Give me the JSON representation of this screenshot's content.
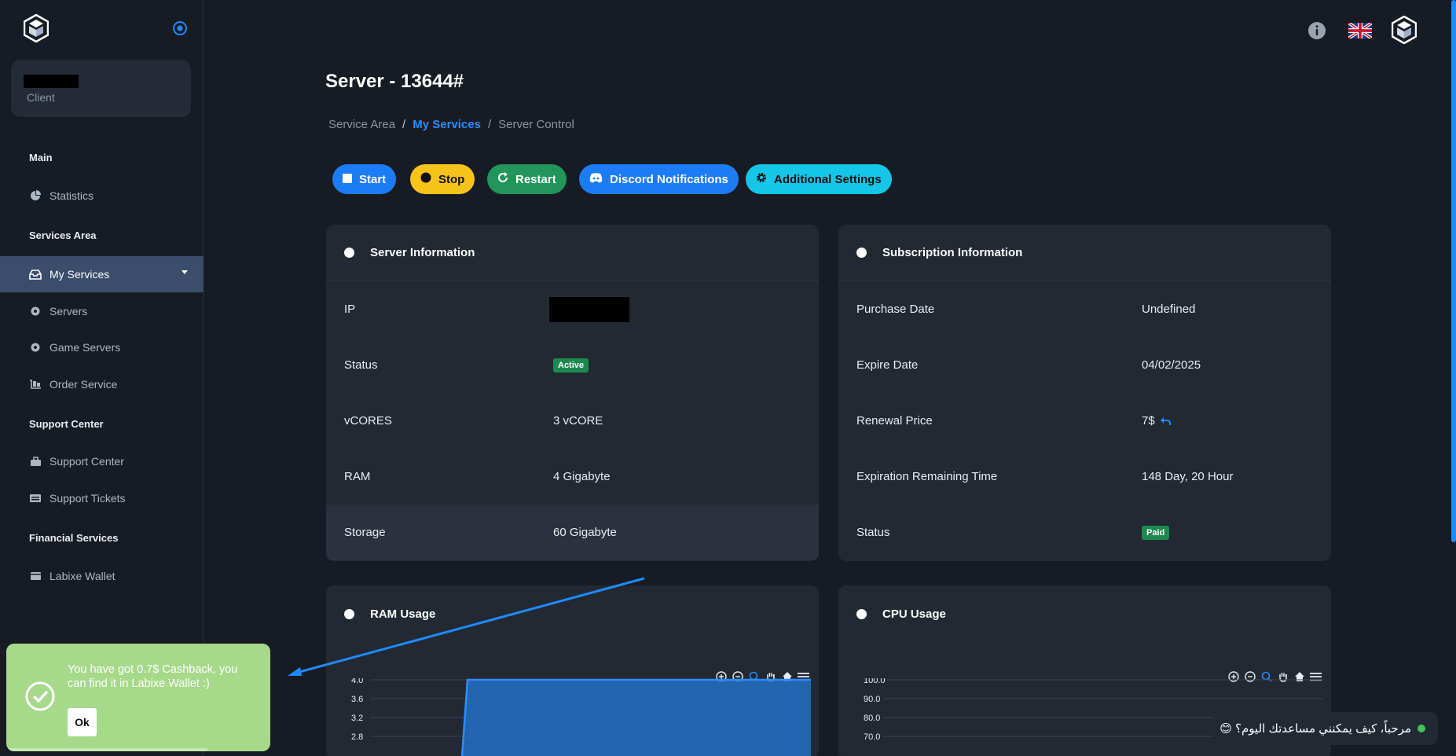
{
  "sidebar": {
    "user_role": "Client",
    "sections": {
      "main": "Main",
      "services_area": "Services Area",
      "support_center": "Support Center",
      "financial": "Financial Services"
    },
    "items": {
      "statistics": "Statistics",
      "my_services": "My Services",
      "servers": "Servers",
      "game_servers": "Game Servers",
      "order_service": "Order Service",
      "support_center": "Support Center",
      "support_tickets": "Support Tickets",
      "wallet": "Labixe Wallet"
    }
  },
  "page": {
    "title": "Server - 13644#",
    "breadcrumb": [
      "Service Area",
      "My Services",
      "Server Control"
    ]
  },
  "actions": {
    "start": "Start",
    "stop": "Stop",
    "restart": "Restart",
    "discord": "Discord Notifications",
    "settings": "Additional Settings"
  },
  "server_info": {
    "title": "Server Information",
    "rows": [
      {
        "label": "IP",
        "value": ""
      },
      {
        "label": "Status",
        "value": "Active"
      },
      {
        "label": "vCORES",
        "value": "3 vCORE"
      },
      {
        "label": "RAM",
        "value": "4 Gigabyte"
      },
      {
        "label": "Storage",
        "value": "60 Gigabyte"
      }
    ]
  },
  "subscription_info": {
    "title": "Subscription Information",
    "rows": [
      {
        "label": "Purchase Date",
        "value": "Undefined"
      },
      {
        "label": "Expire Date",
        "value": "04/02/2025"
      },
      {
        "label": "Renewal Price",
        "value": "7$"
      },
      {
        "label": "Expiration Remaining Time",
        "value": "148 Day, 20 Hour"
      },
      {
        "label": "Status",
        "value": "Paid"
      }
    ]
  },
  "ram_chart": {
    "title": "RAM Usage",
    "chart_data": {
      "type": "area",
      "yticks": [
        "4.0",
        "3.6",
        "3.2",
        "2.8"
      ]
    }
  },
  "cpu_chart": {
    "title": "CPU Usage",
    "chart_data": {
      "type": "area",
      "yticks": [
        "100.0",
        "90.0",
        "80.0",
        "70.0"
      ]
    }
  },
  "toast": {
    "message": "You have got 0.7$ Cashback, you can find it in Labixe Wallet :)",
    "ok": "Ok"
  },
  "chat": {
    "greeting": "مرحباً، كيف يمكنني مساعدتك اليوم؟ 😊"
  },
  "colors": {
    "accent": "#1b7cf5",
    "warning": "#f6c31b",
    "success": "#21955a",
    "info": "#16c6e8"
  }
}
